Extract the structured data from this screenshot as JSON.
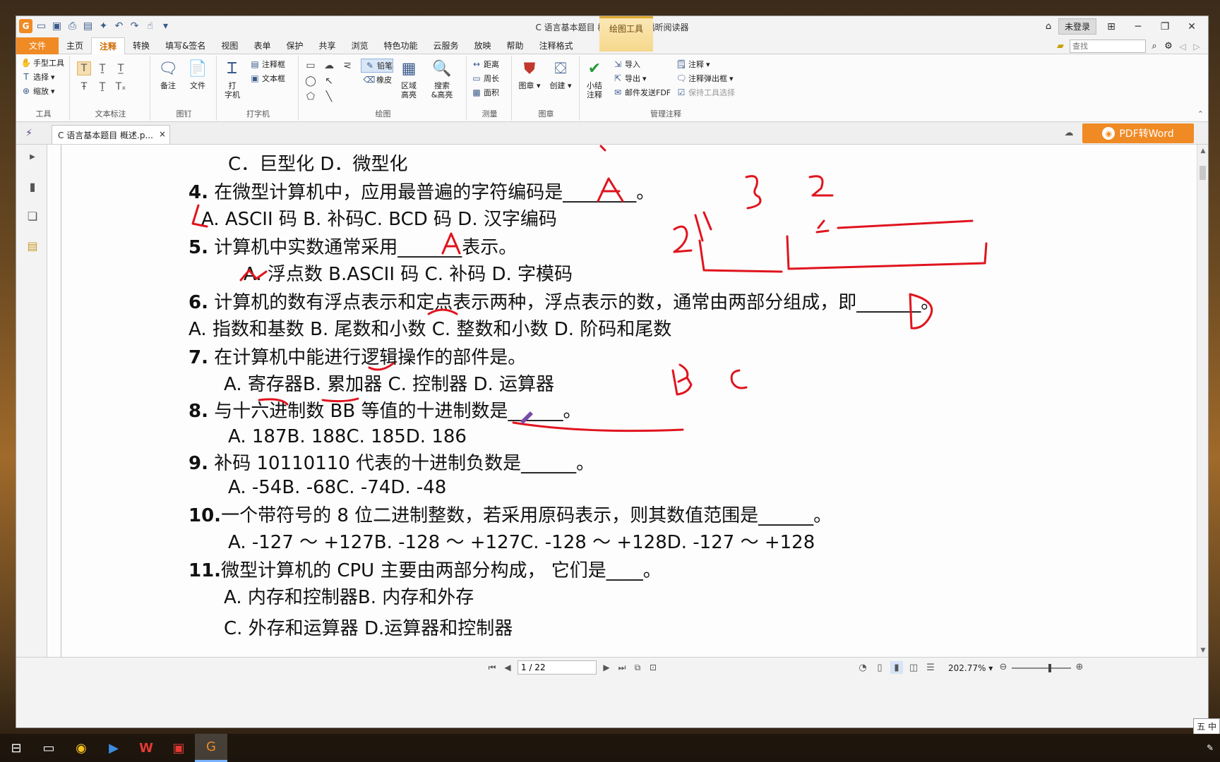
{
  "window": {
    "title": "C 语言基本题目 概述.pdf * - 福昕阅读器",
    "tools_header": "绘图工具"
  },
  "title_bar": {
    "login": "未登录"
  },
  "menu": [
    "文件",
    "主页",
    "注释",
    "转换",
    "填写&签名",
    "视图",
    "表单",
    "保护",
    "共享",
    "浏览",
    "特色功能",
    "云服务",
    "放映",
    "帮助",
    "注释格式"
  ],
  "search": {
    "placeholder": "查找"
  },
  "ribbon": {
    "tools": {
      "hand": "手型工具",
      "select": "选择",
      "zoom": "缩放",
      "label": "工具"
    },
    "text_markup": {
      "label": "文本标注"
    },
    "pin": {
      "note": "备注",
      "file": "文件",
      "label": "图钉"
    },
    "typewriter": {
      "type_a": "打",
      "type_b": "字机",
      "callout": "注释框",
      "textbox": "文本框",
      "label": "打字机"
    },
    "drawing": {
      "pencil": "铅笔",
      "eraser": "橡皮",
      "area_line1": "区域",
      "area_line2": "高亮",
      "search_line1": "搜索",
      "search_line2": "&高亮",
      "label": "绘图"
    },
    "measure": {
      "distance": "距离",
      "perimeter": "周长",
      "area": "面积",
      "label": "测量"
    },
    "stamp": {
      "stamp": "图章",
      "create": "创建",
      "label": "图章"
    },
    "manage": {
      "summary_line1": "小结",
      "summary_line2": "注释",
      "import": "导入",
      "export": "导出",
      "email": "邮件发送FDF",
      "annotations": "注释",
      "popup": "注释弹出框",
      "keep_tool": "保持工具选择",
      "label": "管理注释"
    }
  },
  "tab": {
    "title": "C 语言基本题目 概述.p...",
    "close": "×"
  },
  "pdf_to_word": "PDF转Word",
  "document": {
    "lines": [
      {
        "text": "C．巨型化 D．微型化"
      },
      {
        "num": "4.",
        "text": "在微型计算机中，应用最普遍的字符编码是________。"
      },
      {
        "text": "A. ASCII 码 B. 补码C. BCD 码 D. 汉字编码"
      },
      {
        "num": "5.",
        "text": "计算机中实数通常采用_______表示。"
      },
      {
        "text": "A. 浮点数 B.ASCII 码 C. 补码 D. 字模码"
      },
      {
        "num": "6.",
        "text": "计算机的数有浮点表示和定点表示两种，浮点表示的数，通常由两部分组成，即_______。"
      },
      {
        "text": "A. 指数和基数 B. 尾数和小数 C. 整数和小数 D. 阶码和尾数"
      },
      {
        "num": "7.",
        "text": "在计算机中能进行逻辑操作的部件是。"
      },
      {
        "text": "A. 寄存器B. 累加器 C. 控制器 D. 运算器"
      },
      {
        "num": "8.",
        "text": "与十六进制数 BB 等值的十进制数是______。"
      },
      {
        "text": "A. 187B. 188C. 185D. 186"
      },
      {
        "num": "9.",
        "text": "补码 10110110 代表的十进制负数是______。"
      },
      {
        "text": "A. -54B. -68C. -74D. -48"
      },
      {
        "num": "10.",
        "text": "一个带符号的 8 位二进制整数，若采用原码表示，则其数值范围是______。"
      },
      {
        "text": "A. -127 ～ +127B. -128 ～ +127C. -128 ～ +128D. -127 ～ +128"
      },
      {
        "num": "11.",
        "text": "微型计算机的 CPU 主要由两部分构成， 它们是____。"
      },
      {
        "text": "A. 内存和控制器B. 内存和外存"
      },
      {
        "text": "C. 外存和运算器 D.运算器和控制器"
      }
    ]
  },
  "status": {
    "page": "1 / 22",
    "zoom": "202.77%"
  },
  "taskbar": {
    "ime": "五 中"
  },
  "colors": {
    "accent": "#f08a24",
    "ink": "#e0141e"
  }
}
